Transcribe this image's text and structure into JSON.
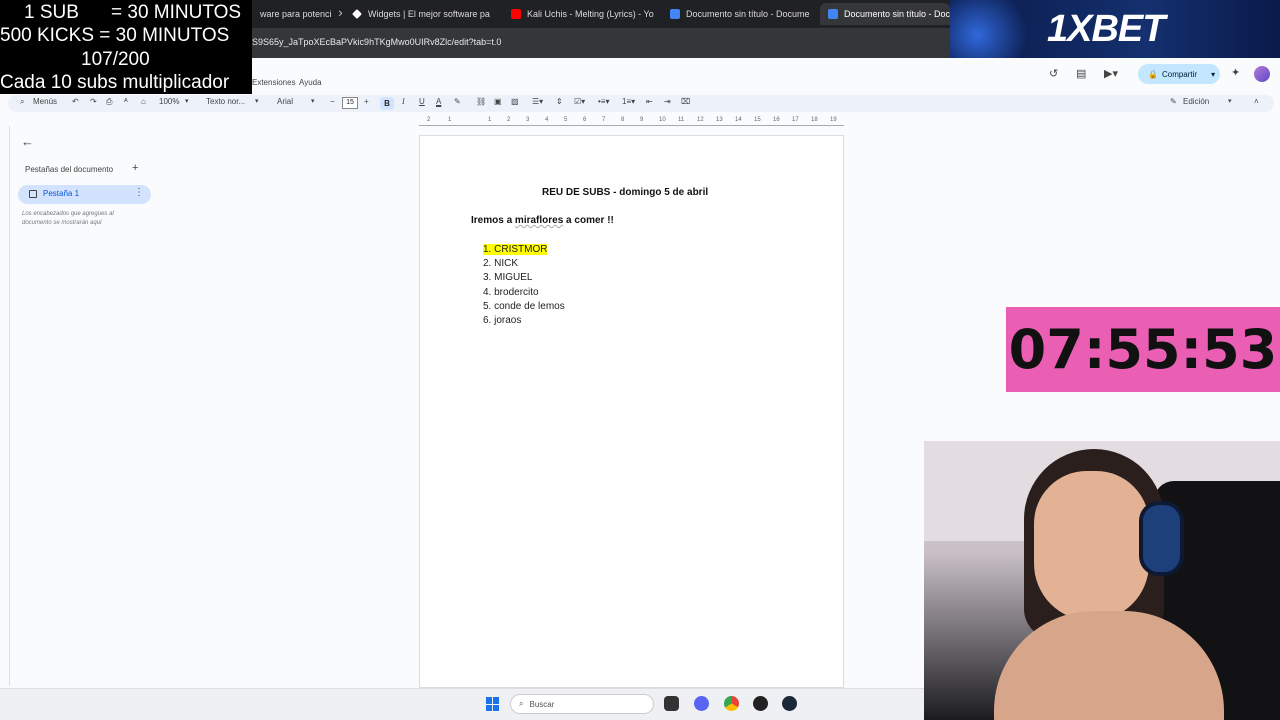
{
  "browser": {
    "tabs": [
      {
        "label": "ware para potenci",
        "active": false
      },
      {
        "label": "Widgets | El mejor software pa",
        "active": false
      },
      {
        "label": "Kali Uchis - Melting (Lyrics) - Yo",
        "active": false
      },
      {
        "label": "Documento sin título - Docume",
        "active": false
      },
      {
        "label": "Documento sin título - Docum",
        "active": true
      }
    ],
    "url": "S9S65y_JaTpoXEcBaPVkic9hTKgMwo0UIRv8Zlc/edit?tab=t.0"
  },
  "docs": {
    "menu": [
      "Extensiones",
      "Ayuda"
    ],
    "share_label": "Compartir",
    "mode_label": "Edición",
    "toolbar": {
      "menus_label": "Menús",
      "zoom": "100%",
      "style": "Texto nor...",
      "font": "Arial",
      "font_size": "15",
      "bold": "B",
      "italic": "I",
      "underline": "U",
      "text_color": "A"
    },
    "ruler_ticks": [
      "2",
      "1",
      "1",
      "2",
      "3",
      "4",
      "5",
      "6",
      "7",
      "8",
      "9",
      "10",
      "11",
      "12",
      "13",
      "14",
      "15",
      "16",
      "17",
      "18",
      "19"
    ]
  },
  "sidebar": {
    "title": "Pestañas del documento",
    "tab_label": "Pestaña 1",
    "note": "Los encabezados que agregues al documento se mostrarán aquí"
  },
  "document": {
    "title": "REU DE SUBS - domingo 5 de abril",
    "line_prefix": "Iremos a ",
    "line_place": "miraflores",
    "line_suffix": " a comer !!",
    "list": [
      {
        "num": "1.",
        "text": "CRISTMOR",
        "highlight": true
      },
      {
        "num": "2.",
        "text": "NICK",
        "highlight": false
      },
      {
        "num": "3.",
        "text": "MIGUEL",
        "highlight": false
      },
      {
        "num": "4.",
        "text": "brodercito",
        "highlight": false
      },
      {
        "num": "5.",
        "text": "conde de lemos",
        "highlight": false
      },
      {
        "num": "6.",
        "text": "joraos",
        "highlight": false
      }
    ]
  },
  "overlay": {
    "line1_a": "1 SUB",
    "line1_b": "= 30 MINUTOS",
    "line2": "500 KICKS = 30 MINUTOS",
    "line3": "107/200",
    "line4": "Cada 10 subs multiplicador",
    "sponsor": "1XBET",
    "timer": "07:55:53"
  },
  "taskbar": {
    "search_placeholder": "Buscar"
  },
  "colors": {
    "timer_bg": "#ea5fb3",
    "highlight": "#ffff00",
    "share_bg": "#c2e7ff",
    "accent": "#0b57d0"
  }
}
